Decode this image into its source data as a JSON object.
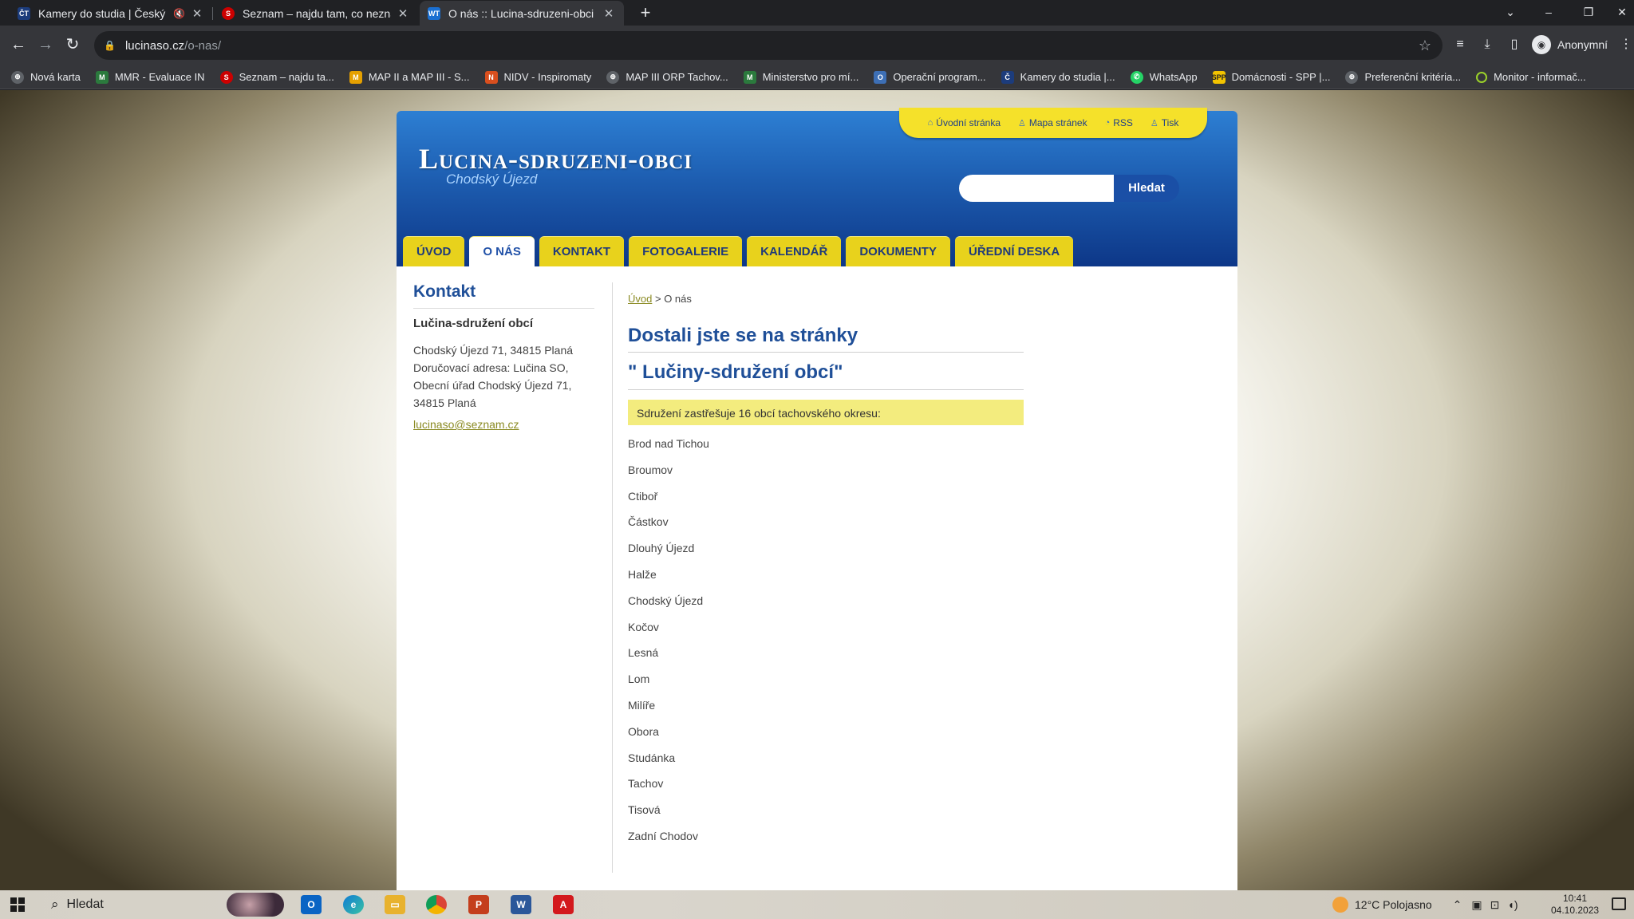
{
  "browser": {
    "tabs": [
      {
        "title": "Kamery do studia | Český ro",
        "icon": "ct-icon",
        "muted": true
      },
      {
        "title": "Seznam – najdu tam, co neznám",
        "icon": "seznam-icon"
      },
      {
        "title": "O nás :: Lucina-sdruzeni-obci",
        "icon": "site-favicon",
        "active": true
      }
    ],
    "url_host": "lucinaso.cz",
    "url_path": "/o-nas/",
    "profile_label": "Anonymní",
    "bookmarks": [
      {
        "label": "Nová karta",
        "icon": "globe-icon"
      },
      {
        "label": "MMR - Evaluace IN",
        "icon": "mmr-icon"
      },
      {
        "label": "Seznam – najdu ta...",
        "icon": "seznam-icon"
      },
      {
        "label": "MAP II a MAP III - S...",
        "icon": "map-icon"
      },
      {
        "label": "NIDV - Inspiromaty",
        "icon": "nidv-icon"
      },
      {
        "label": "MAP III ORP Tachov...",
        "icon": "globe-icon"
      },
      {
        "label": "Ministerstvo pro mí...",
        "icon": "mmr-icon"
      },
      {
        "label": "Operační program...",
        "icon": "op-icon"
      },
      {
        "label": "Kamery do studia |...",
        "icon": "ct-icon"
      },
      {
        "label": "WhatsApp",
        "icon": "whatsapp-icon"
      },
      {
        "label": "Domácnosti - SPP |...",
        "icon": "spp-icon"
      },
      {
        "label": "Preferenční kritéria...",
        "icon": "globe-icon"
      },
      {
        "label": "Monitor - informač...",
        "icon": "monitor-icon"
      }
    ]
  },
  "site": {
    "top_links": [
      "Úvodní stránka",
      "Mapa stránek",
      "RSS",
      "Tisk"
    ],
    "logo": "Lucina-sdruzeni-obci",
    "subtitle": "Chodský Újezd",
    "search_button": "Hledat",
    "search_value": "",
    "nav": [
      "ÚVOD",
      "O NÁS",
      "KONTAKT",
      "FOTOGALERIE",
      "KALENDÁŘ",
      "DOKUMENTY",
      "ÚŘEDNÍ DESKA"
    ],
    "nav_active_index": 1
  },
  "sidebar": {
    "title": "Kontakt",
    "org": "Lučina-sdružení obcí",
    "address": "Chodský Újezd 71, 34815 Planá Doručovací adresa: Lučina SO, Obecní úřad Chodský Újezd 71, 34815 Planá",
    "email": "lucinaso@seznam.cz"
  },
  "content": {
    "breadcrumb_home": "Úvod",
    "breadcrumb_sep": ">",
    "breadcrumb_current": "O nás",
    "heading_1": "Dostali jste se na stránky",
    "heading_2": "\" Lučiny-sdružení obcí\"",
    "intro": "Sdružení zastřešuje 16 obcí tachovského okresu:",
    "villages": [
      "Brod nad Tichou",
      "Broumov",
      "Ctiboř",
      "Částkov",
      "Dlouhý Újezd",
      "Halže",
      "Chodský Újezd",
      "Kočov",
      "Lesná",
      "Lom",
      "Milíře",
      "Obora",
      "Studánka",
      "Tachov",
      "Tisová",
      "Zadní Chodov"
    ]
  },
  "taskbar": {
    "search_label": "Hledat",
    "weather": "12°C  Polojasno",
    "time": "10:41",
    "date": "04.10.2023"
  },
  "colors": {
    "header_blue": "#1d5db0",
    "nav_yellow": "#e8d21c",
    "heading_blue": "#1f4f98",
    "link_olive": "#8a8a22",
    "intro_yellow": "#f3ec7e"
  }
}
